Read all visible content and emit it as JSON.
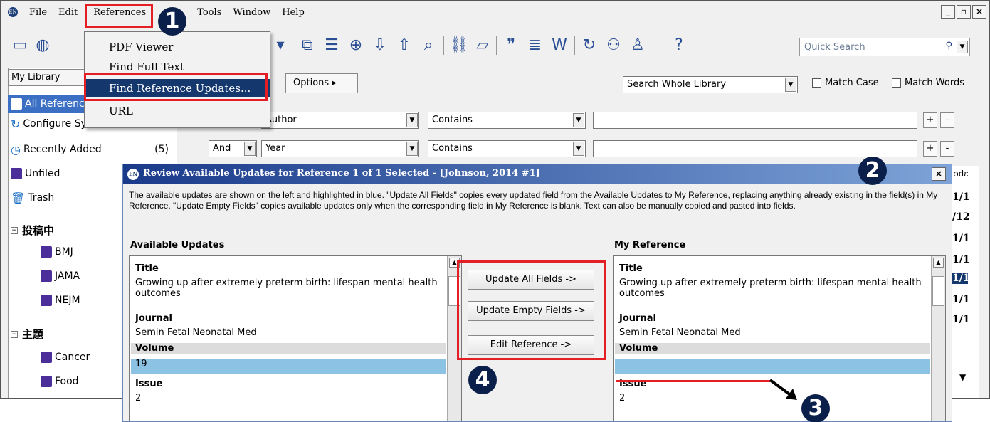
{
  "menubar": {
    "items": [
      "File",
      "Edit",
      "References",
      "Tools",
      "Window",
      "Help"
    ]
  },
  "toolbar": {
    "quick_search_placeholder": "Quick Search",
    "icons": [
      "folder-icon",
      "globe-icon",
      "copy-icon",
      "insert-icon",
      "quote-icon",
      "search-online-icon",
      "import-icon",
      "export-icon",
      "find-text-icon",
      "link-icon",
      "open-folder-icon",
      "quote-marks-icon",
      "format-icon",
      "word-icon",
      "sync-icon",
      "share-icon",
      "user-icon",
      "help-icon"
    ]
  },
  "library": {
    "selector": "My Library",
    "groups": [
      {
        "label": "All References",
        "count": ""
      },
      {
        "label": "Configure Sync",
        "count": ""
      },
      {
        "label": "Recently Added",
        "count": "(5)"
      },
      {
        "label": "Unfiled",
        "count": ""
      },
      {
        "label": "Trash",
        "count": ""
      }
    ],
    "sets": [
      {
        "name": "投稿中",
        "groups": [
          "BMJ",
          "JAMA",
          "NEJM"
        ]
      },
      {
        "name": "主題",
        "groups": [
          "Cancer",
          "Food"
        ]
      }
    ]
  },
  "references_menu": {
    "items": [
      "PDF Viewer",
      "Find Full Text",
      "Find Reference Updates...",
      "URL"
    ],
    "highlighted": "Find Reference Updates..."
  },
  "search": {
    "options_label": "Options ▸",
    "scope": "Search Whole Library",
    "match_case": "Match Case",
    "match_words": "Match Words",
    "rows": [
      {
        "bool": "",
        "field": "Author",
        "op": "Contains",
        "value": ""
      },
      {
        "bool": "And",
        "field": "Year",
        "op": "Contains",
        "value": ""
      }
    ]
  },
  "dialog": {
    "title": "Review Available Updates for Reference 1 of 1 Selected - [Johnson, 2014 #1]",
    "description": "The available updates are shown on the left and highlighted in blue. \"Update All Fields\" copies every updated field from the Available Updates to My Reference, replacing anything already existing in the field(s) in My Reference. \"Update Empty Fields\" copies available updates only when the corresponding field in My Reference is blank. Text can also be manually copied and pasted into fields.",
    "available_label": "Available Updates",
    "my_label": "My Reference",
    "buttons": {
      "update_all": "Update All Fields ->",
      "update_empty": "Update Empty Fields ->",
      "edit": "Edit Reference ->"
    },
    "available": {
      "title_label": "Title",
      "title": "Growing up after extremely preterm birth: lifespan mental health outcomes",
      "journal_label": "Journal",
      "journal": "Semin Fetal Neonatal Med",
      "volume_label": "Volume",
      "volume": "19",
      "issue_label": "Issue",
      "issue": "2"
    },
    "mine": {
      "title_label": "Title",
      "title": "Growing up after extremely preterm birth: lifespan mental health outcomes",
      "journal_label": "Journal",
      "journal": "Semin Fetal Neonatal Med",
      "volume_label": "Volume",
      "volume": "",
      "issue_label": "Issue",
      "issue": "2"
    }
  },
  "right_strip": {
    "header": "ɔdɛ",
    "values": [
      "1/1",
      "/12",
      "1/1",
      "1/1",
      "1/1",
      "1/1",
      "1/1"
    ]
  },
  "annotations": {
    "callouts": [
      "1",
      "2",
      "3",
      "4"
    ],
    "color": "#e31e24"
  }
}
